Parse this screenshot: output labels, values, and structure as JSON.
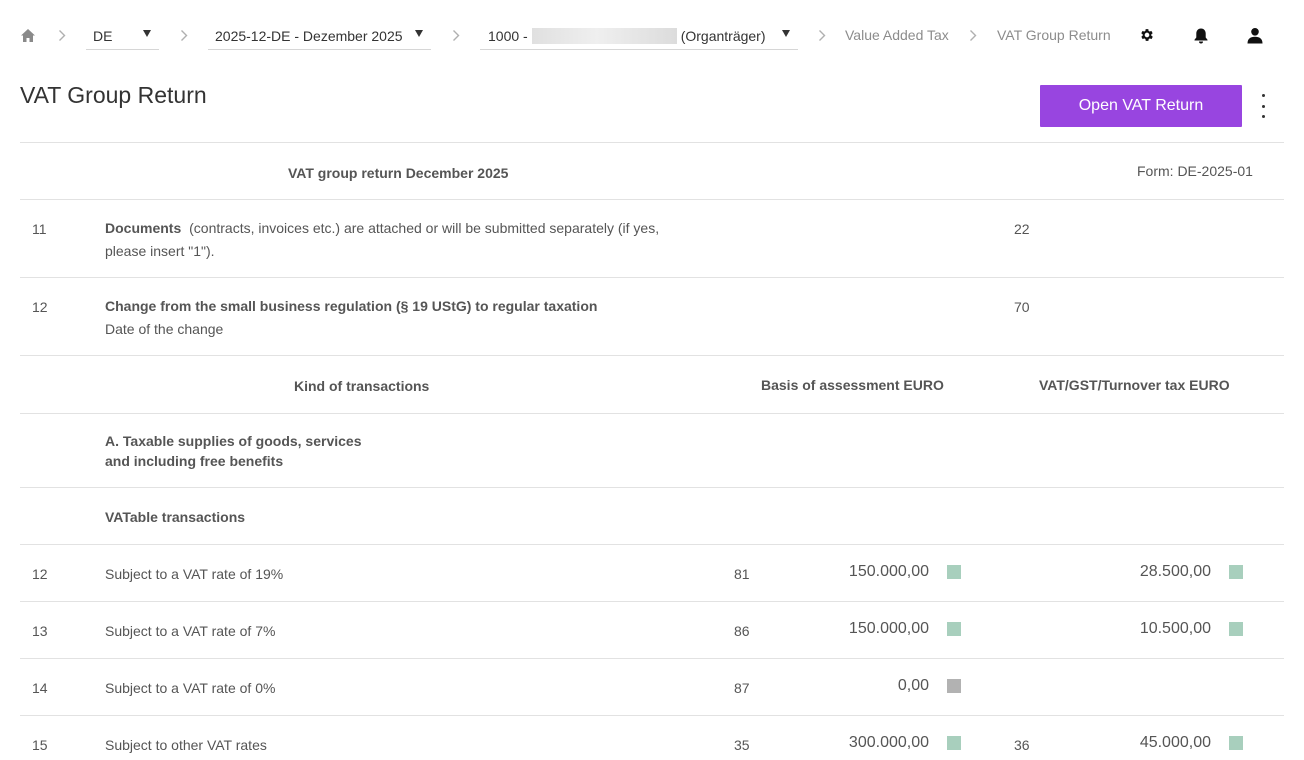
{
  "breadcrumb": {
    "country_value": "DE",
    "period_value": "2025-12-DE - Dezember 2025",
    "entity_prefix": "1000 -",
    "entity_suffix": "(Organträger)",
    "crumb_1": "Value Added Tax",
    "crumb_2": "VAT Group Return"
  },
  "icons": {
    "home": "home-icon",
    "settings": "gear-icon",
    "notifications": "bell-icon",
    "account": "user-icon"
  },
  "header": {
    "title": "VAT Group Return",
    "open_button": "Open VAT Return"
  },
  "colors": {
    "primary": "#9845e0",
    "status_ok": "#a8cfbd",
    "status_empty": "#b2b2b2"
  },
  "form": {
    "heading": "VAT group return December 2025",
    "form_id": "Form: DE-2025-01",
    "row_documents": {
      "line": "11",
      "title": "Documents",
      "text_1": "(contracts, invoices etc.) are attached or will be submitted separately (if yes,",
      "text_2": "please insert \"1\").",
      "code": "22"
    },
    "row_change": {
      "line": "12",
      "title": "Change from the small business regulation (§ 19 UStG) to regular taxation",
      "subtitle": "Date of the change",
      "code": "70"
    },
    "columns": {
      "kind": "Kind of transactions",
      "basis": "Basis of assessment EURO",
      "tax": "VAT/GST/Turnover tax EURO"
    },
    "section_a_line1": "A. Taxable supplies of goods, services",
    "section_a_line2": "and including free benefits",
    "subsection": "VATable transactions",
    "rows": [
      {
        "line": "12",
        "label": "Subject to a VAT rate of 19%",
        "code": "81",
        "basis": "150.000,00",
        "basis_status": "green",
        "tax_code": "",
        "tax": "28.500,00",
        "tax_status": "green"
      },
      {
        "line": "13",
        "label": "Subject to a VAT rate of 7%",
        "code": "86",
        "basis": "150.000,00",
        "basis_status": "green",
        "tax_code": "",
        "tax": "10.500,00",
        "tax_status": "green"
      },
      {
        "line": "14",
        "label": "Subject to a VAT rate of 0%",
        "code": "87",
        "basis": "0,00",
        "basis_status": "grey",
        "tax_code": "",
        "tax": "",
        "tax_status": ""
      },
      {
        "line": "15",
        "label": "Subject to other VAT rates",
        "code": "35",
        "basis": "300.000,00",
        "basis_status": "green",
        "tax_code": "36",
        "tax": "45.000,00",
        "tax_status": "green"
      }
    ]
  }
}
